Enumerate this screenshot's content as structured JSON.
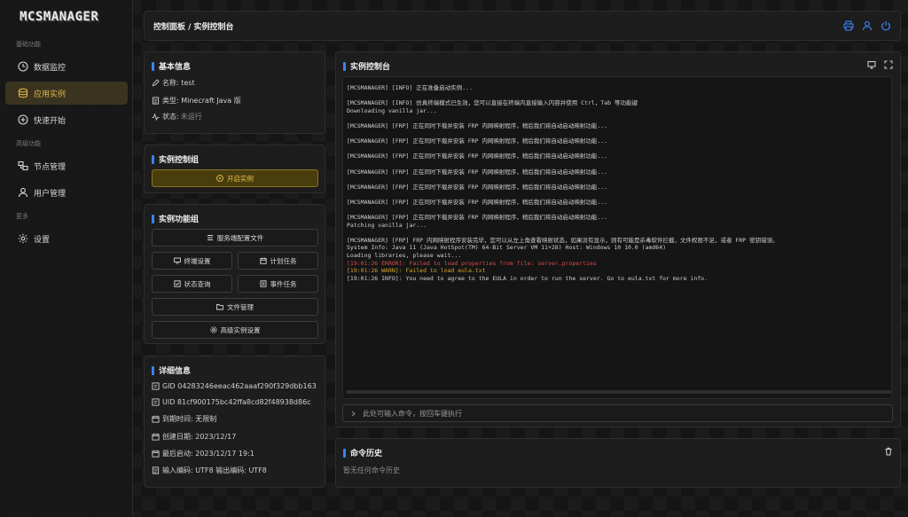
{
  "app": {
    "logo": "MCSMANAGER"
  },
  "sidebar": {
    "sections": [
      "基础功能",
      "高级功能",
      "更多"
    ],
    "items": [
      {
        "label": "数据监控",
        "icon": "dashboard-icon"
      },
      {
        "label": "应用实例",
        "icon": "database-icon",
        "active": true
      },
      {
        "label": "快速开始",
        "icon": "plus-circle-icon"
      },
      {
        "label": "节点管理",
        "icon": "cluster-icon"
      },
      {
        "label": "用户管理",
        "icon": "user-icon"
      },
      {
        "label": "设置",
        "icon": "gear-icon"
      }
    ]
  },
  "topbar": {
    "breadcrumb": "控制面板 / 实例控制台"
  },
  "basic_info": {
    "title": "基本信息",
    "name": "名称: test",
    "type": "类型: Minecraft Java 版",
    "status_label": "状态:",
    "status_value": "未运行"
  },
  "control_group": {
    "title": "实例控制组",
    "start_button": "开启实例"
  },
  "function_group": {
    "title": "实例功能组",
    "service_config": "服务端配置文件",
    "terminal_settings": "终端设置",
    "scheduled_tasks": "计划任务",
    "status_query": "状态查询",
    "event_tasks": "事件任务",
    "file_management": "文件管理",
    "advanced_settings": "高级实例设置"
  },
  "details": {
    "title": "详细信息",
    "gid": "GID 04283246eeac462aaaf290f329dbb163",
    "uid": "UID 81cf900175bc42ffa8cd82f48938d86c",
    "expire": "到期时间: 无限制",
    "created": "创建日期: 2023/12/17",
    "last_start": "最后启动: 2023/12/17 19:1",
    "encoding": "输入编码: UTF8 输出编码: UTF8"
  },
  "console": {
    "title": "实例控制台",
    "lines": [
      {
        "text": "[MCSMANAGER] [INFO] 正在准备启动实例...",
        "type": "normal"
      },
      {
        "text": "",
        "type": "gap"
      },
      {
        "text": "[MCSMANAGER] [INFO] 仿真终端模式已生效，您可以直接在终端内直接输入内容并使用 Ctrl，Tab 等功能键",
        "type": "normal"
      },
      {
        "text": "Downloading vanilla jar...",
        "type": "normal"
      },
      {
        "text": "",
        "type": "gap"
      },
      {
        "text": "[MCSMANAGER] [FRP] 正在同时下载并安装 FRP 内网映射程序，稍后我们将自动启动映射功能...",
        "type": "normal"
      },
      {
        "text": "",
        "type": "gap"
      },
      {
        "text": "[MCSMANAGER] [FRP] 正在同时下载并安装 FRP 内网映射程序，稍后我们将自动启动映射功能...",
        "type": "normal"
      },
      {
        "text": "",
        "type": "gap"
      },
      {
        "text": "[MCSMANAGER] [FRP] 正在同时下载并安装 FRP 内网映射程序，稍后我们将自动启动映射功能...",
        "type": "normal"
      },
      {
        "text": "",
        "type": "gap"
      },
      {
        "text": "[MCSMANAGER] [FRP] 正在同时下载并安装 FRP 内网映射程序，稍后我们将自动启动映射功能...",
        "type": "normal"
      },
      {
        "text": "",
        "type": "gap"
      },
      {
        "text": "[MCSMANAGER] [FRP] 正在同时下载并安装 FRP 内网映射程序，稍后我们将自动启动映射功能...",
        "type": "normal"
      },
      {
        "text": "",
        "type": "gap"
      },
      {
        "text": "[MCSMANAGER] [FRP] 正在同时下载并安装 FRP 内网映射程序，稍后我们将自动启动映射功能...",
        "type": "normal"
      },
      {
        "text": "",
        "type": "gap"
      },
      {
        "text": "[MCSMANAGER] [FRP] 正在同时下载并安装 FRP 内网映射程序，稍后我们将自动启动映射功能...",
        "type": "normal"
      },
      {
        "text": "Patching vanilla jar...",
        "type": "normal"
      },
      {
        "text": "",
        "type": "gap"
      },
      {
        "text": "[MCSMANAGER] [FRP] FRP 内网映射程序安装完毕，您可以从左上角查看映射状态，如果没有显示，则有可能是杀毒软件拦截，文件权限不足，或者 FRP 密钥错误。",
        "type": "normal"
      },
      {
        "text": "System Info: Java 11 (Java HotSpot(TM) 64-Bit Server VM 11+28) Host: Windows 10 10.0 (amd64)",
        "type": "normal"
      },
      {
        "text": "Loading libraries, please wait...",
        "type": "normal"
      },
      {
        "text": "[19:01:26 ERROR]: Failed to load properties from file: server.properties",
        "type": "err"
      },
      {
        "text": "[19:01:26 WARN]: Failed to load eula.txt",
        "type": "warn"
      },
      {
        "text": "[19:01:26 INFO]: You need to agree to the EULA in order to run the server. Go to eula.txt for more info.",
        "type": "normal"
      }
    ],
    "input_placeholder": "此处可输入命令，按回车键执行"
  },
  "history": {
    "title": "命令历史",
    "empty": "暂无任何命令历史"
  },
  "colors": {
    "accent": "#3b82f6",
    "active": "#e0b64a",
    "error": "#d94b4b",
    "warn": "#d0a42b"
  }
}
